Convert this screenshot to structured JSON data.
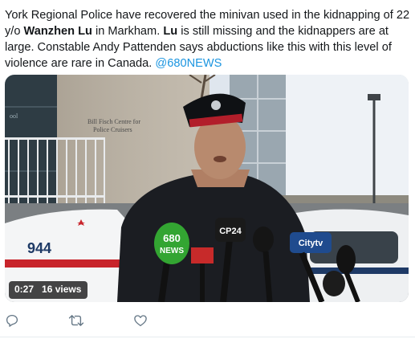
{
  "tweet": {
    "text_parts": {
      "p1": "York Regional Police have recovered the minivan used in the kidnapping of 22 y/o ",
      "name1": "Wanzhen Lu",
      "p2": " in Markham. ",
      "name2": "Lu",
      "p3": " is still missing and the kidnappers are at large. Constable Andy Pattenden says abductions like this with this level of violence are rare in Canada. ",
      "mention": "@680NEWS"
    },
    "video": {
      "duration": "0:27",
      "views": "16 views",
      "scene_text": {
        "building_sign_line1": "Bill Fisch Centre for",
        "building_sign_line2": "Police Cruisers",
        "building_door_text": "ool",
        "car_number": "944",
        "mic_680_line1": "680",
        "mic_680_line2": "NEWS",
        "mic_cp24": "CP24",
        "mic_citytv": "Citytv"
      }
    }
  },
  "actions": {
    "icons": [
      "reply-icon",
      "retweet-icon",
      "like-icon"
    ]
  },
  "colors": {
    "text": "#14171a",
    "link": "#1b95e0",
    "action_icon": "#657786",
    "divider": "#e6ecf0"
  }
}
